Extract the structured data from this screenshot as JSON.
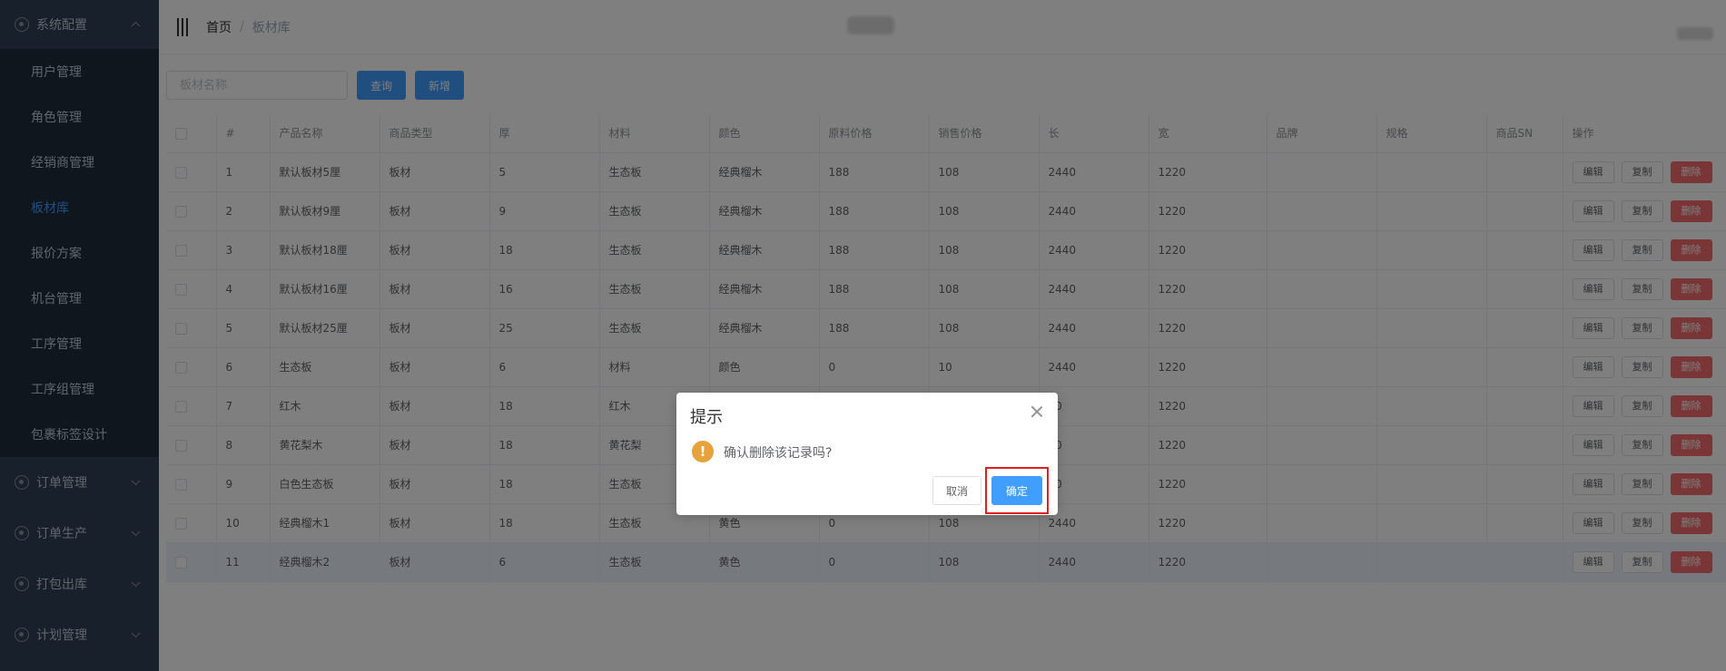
{
  "sidebar": {
    "groups": [
      {
        "label": "系统配置",
        "expanded": true,
        "items": [
          {
            "label": "用户管理",
            "active": false
          },
          {
            "label": "角色管理",
            "active": false
          },
          {
            "label": "经销商管理",
            "active": false
          },
          {
            "label": "板材库",
            "active": true
          },
          {
            "label": "报价方案",
            "active": false
          },
          {
            "label": "机台管理",
            "active": false
          },
          {
            "label": "工序管理",
            "active": false
          },
          {
            "label": "工序组管理",
            "active": false
          },
          {
            "label": "包裹标签设计",
            "active": false
          }
        ]
      },
      {
        "label": "订单管理",
        "expanded": false
      },
      {
        "label": "订单生产",
        "expanded": false
      },
      {
        "label": "打包出库",
        "expanded": false
      },
      {
        "label": "计划管理",
        "expanded": false
      }
    ]
  },
  "breadcrumb": {
    "home": "首页",
    "separator": "/",
    "current": "板材库"
  },
  "toolbar": {
    "search_placeholder": "板材名称",
    "search_value": "",
    "query_label": "查询",
    "add_label": "新增"
  },
  "table": {
    "columns": [
      "#",
      "产品名称",
      "商品类型",
      "厚",
      "材料",
      "颜色",
      "原料价格",
      "销售价格",
      "长",
      "宽",
      "品牌",
      "规格",
      "商品SN",
      "操作"
    ],
    "actions": {
      "edit": "编辑",
      "copy": "复制",
      "delete": "删除"
    },
    "rows": [
      {
        "no": "1",
        "name": "默认板材5厘",
        "type": "板材",
        "thick": "5",
        "material": "生态板",
        "color": "经典榴木",
        "raw_price": "188",
        "sale_price": "108",
        "length": "2440",
        "width": "1220",
        "brand": "",
        "spec": "",
        "sn": ""
      },
      {
        "no": "2",
        "name": "默认板材9厘",
        "type": "板材",
        "thick": "9",
        "material": "生态板",
        "color": "经典榴木",
        "raw_price": "188",
        "sale_price": "108",
        "length": "2440",
        "width": "1220",
        "brand": "",
        "spec": "",
        "sn": ""
      },
      {
        "no": "3",
        "name": "默认板材18厘",
        "type": "板材",
        "thick": "18",
        "material": "生态板",
        "color": "经典榴木",
        "raw_price": "188",
        "sale_price": "108",
        "length": "2440",
        "width": "1220",
        "brand": "",
        "spec": "",
        "sn": ""
      },
      {
        "no": "4",
        "name": "默认板材16厘",
        "type": "板材",
        "thick": "16",
        "material": "生态板",
        "color": "经典榴木",
        "raw_price": "188",
        "sale_price": "108",
        "length": "2440",
        "width": "1220",
        "brand": "",
        "spec": "",
        "sn": ""
      },
      {
        "no": "5",
        "name": "默认板材25厘",
        "type": "板材",
        "thick": "25",
        "material": "生态板",
        "color": "经典榴木",
        "raw_price": "188",
        "sale_price": "108",
        "length": "2440",
        "width": "1220",
        "brand": "",
        "spec": "",
        "sn": ""
      },
      {
        "no": "6",
        "name": "生态板",
        "type": "板材",
        "thick": "6",
        "material": "材料",
        "color": "颜色",
        "raw_price": "0",
        "sale_price": "10",
        "length": "2440",
        "width": "1220",
        "brand": "",
        "spec": "",
        "sn": ""
      },
      {
        "no": "7",
        "name": "红木",
        "type": "板材",
        "thick": "18",
        "material": "红木",
        "color": "",
        "raw_price": "",
        "sale_price": "",
        "length": "40",
        "width": "1220",
        "brand": "",
        "spec": "",
        "sn": ""
      },
      {
        "no": "8",
        "name": "黄花梨木",
        "type": "板材",
        "thick": "18",
        "material": "黄花梨",
        "color": "",
        "raw_price": "",
        "sale_price": "",
        "length": "40",
        "width": "1220",
        "brand": "",
        "spec": "",
        "sn": ""
      },
      {
        "no": "9",
        "name": "白色生态板",
        "type": "板材",
        "thick": "18",
        "material": "生态板",
        "color": "",
        "raw_price": "",
        "sale_price": "",
        "length": "40",
        "width": "1220",
        "brand": "",
        "spec": "",
        "sn": ""
      },
      {
        "no": "10",
        "name": "经典榴木1",
        "type": "板材",
        "thick": "18",
        "material": "生态板",
        "color": "黄色",
        "raw_price": "0",
        "sale_price": "108",
        "length": "2440",
        "width": "1220",
        "brand": "",
        "spec": "",
        "sn": ""
      },
      {
        "no": "11",
        "name": "经典榴木2",
        "type": "板材",
        "thick": "6",
        "material": "生态板",
        "color": "黄色",
        "raw_price": "0",
        "sale_price": "108",
        "length": "2440",
        "width": "1220",
        "brand": "",
        "spec": "",
        "sn": ""
      }
    ]
  },
  "dialog": {
    "title": "提示",
    "message": "确认删除该记录吗?",
    "cancel_label": "取消",
    "confirm_label": "确定",
    "warning_glyph": "!"
  },
  "colors": {
    "sidebar_bg": "#304156",
    "submenu_bg": "#1f2d3d",
    "primary": "#409eff",
    "danger": "#f56c6c",
    "warning": "#e6a23c",
    "highlight_border": "#e02020"
  },
  "icons": {
    "menu": "hamburger-icon",
    "group": "settings-icon",
    "expand": "chevron-icon",
    "close": "close-icon",
    "warning": "warning-icon"
  }
}
